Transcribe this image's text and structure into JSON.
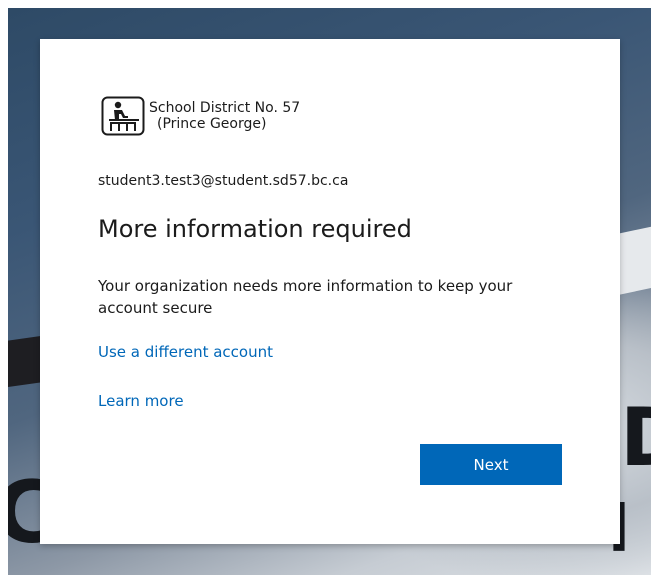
{
  "organization": {
    "logo_line1": "School District No. 57",
    "logo_line2": "(Prince George)",
    "logo_icon": "school-desk-icon"
  },
  "account": {
    "email": "student3.test3@student.sd57.bc.ca"
  },
  "dialog": {
    "title": "More information required",
    "description": "Your organization needs more information to keep your account secure",
    "use_different_account_link": "Use a different account",
    "learn_more_link": "Learn more",
    "next_button": "Next"
  },
  "colors": {
    "link": "#0067b8",
    "primary_button": "#0067b8",
    "text": "#1b1b1b",
    "card_background": "#ffffff"
  }
}
